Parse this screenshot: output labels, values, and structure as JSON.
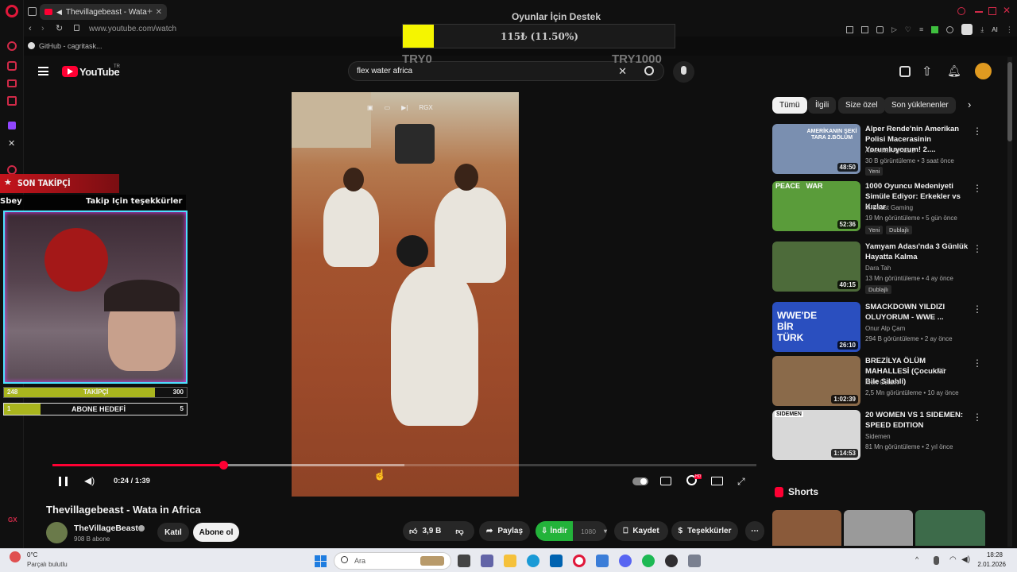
{
  "browser": {
    "tab_title": "Thevillagebeast - Wata",
    "url": "www.youtube.com/watch",
    "bookmark": "GitHub - cagritask..."
  },
  "donation": {
    "title": "Oyunlar İçin Destek",
    "progress_text": "115₺ (11.50%)",
    "progress_fraction": 0.115,
    "min_label": "TRY0",
    "max_label": "TRY1000",
    "fill_color": "#f5f500"
  },
  "youtube": {
    "logo_text": "YouTube",
    "region": "TR",
    "search_value": "flex water africa"
  },
  "overlay": {
    "follower_header": "SON TAKİPÇİ",
    "follower_name": "Sbey",
    "thanks_text": "Takip İçin teşekkürler Fre!",
    "followers": {
      "current": "248",
      "label": "TAKİPÇİ",
      "goal": "300",
      "fraction": 0.827
    },
    "subs": {
      "current": "1",
      "label": "ABONE HEDEFİ",
      "goal": "5",
      "fraction": 0.2
    }
  },
  "player": {
    "time": "0:24 / 1:39",
    "progress_fraction": 0.2424,
    "buffer_fraction": 0.5,
    "hd_badge": "HD"
  },
  "video": {
    "title": "Thevillagebeast - Wata in Africa",
    "channel": "TheVillageBeast",
    "subscribers": "908 B abone",
    "join_label": "Katıl",
    "subscribe_label": "Abone ol",
    "likes": "3,9 B",
    "share_label": "Paylaş",
    "download_label": "İndir",
    "download_quality": "1080",
    "save_label": "Kaydet",
    "thanks_label": "Teşekkürler",
    "overlay_text": "RGX"
  },
  "chips": [
    "Tümü",
    "İlgili",
    "Size özel",
    "Son yüklenenler"
  ],
  "recommendations": [
    {
      "title": "Alper Rende'nin Amerikan Polisi Macerasinin Yorumluyorum! 2....",
      "channel": "Amerikali Aynasiz",
      "meta": "30 B görüntüleme • 3 saat önce",
      "badge": "Yeni",
      "duration": "48:50",
      "color": "#7a8fb0",
      "thumb_text": "AMERİKANIN ŞEKİ TARA 2.BÖLÜM"
    },
    {
      "title": "1000 Oyuncu Medeniyeti Simüle Ediyor: Erkekler vs Kızlar",
      "channel": "MrBeast Gaming",
      "meta": "19 Mn görüntüleme • 5 gün önce",
      "badge": "Yeni",
      "badge2": "Dublajlı",
      "duration": "52:36",
      "color": "#5a9c3a",
      "thumb_text": "PEACE   WAR"
    },
    {
      "title": "Yamyam Adası'nda 3 Günlük Hayatta Kalma",
      "channel": "Dara Tah",
      "meta": "13 Mn görüntüleme • 4 ay önce",
      "badge2": "Dublajlı",
      "duration": "40:15",
      "color": "#4d6b3a",
      "thumb_text": ""
    },
    {
      "title": "SMACKDOWN YILDIZI OLUYORUM - WWE ...",
      "channel": "Onur Alp Çam",
      "meta": "294 B görüntüleme • 2 ay önce",
      "duration": "26:10",
      "color": "#2a4fbf",
      "thumb_text": "WWE'DE BİR TÜRK"
    },
    {
      "title": "BREZİLYA ÖLÜM MAHALLESİ (Çocuklar Bile Silahli)",
      "channel": "Mert Öztürk",
      "meta": "2,5 Mn görüntüleme • 10 ay önce",
      "duration": "1:02:39",
      "color": "#8a6a4a",
      "thumb_text": "",
      "suffix": "BR"
    },
    {
      "title": "20 WOMEN VS 1 SIDEMEN: SPEED EDITION",
      "channel": "Sidemen",
      "meta": "81 Mn görüntüleme • 2 yıl önce",
      "duration": "1:14:53",
      "color": "#d8d8d8",
      "thumb_text": "SIDEMEN"
    }
  ],
  "shorts_label": "Shorts",
  "taskbar": {
    "weather_temp": "0°C",
    "weather_desc": "Parçalı bulutlu",
    "search_placeholder": "Ara",
    "time": "18:28",
    "date": "2.01.2026"
  },
  "sidebar_bottom": "GX"
}
